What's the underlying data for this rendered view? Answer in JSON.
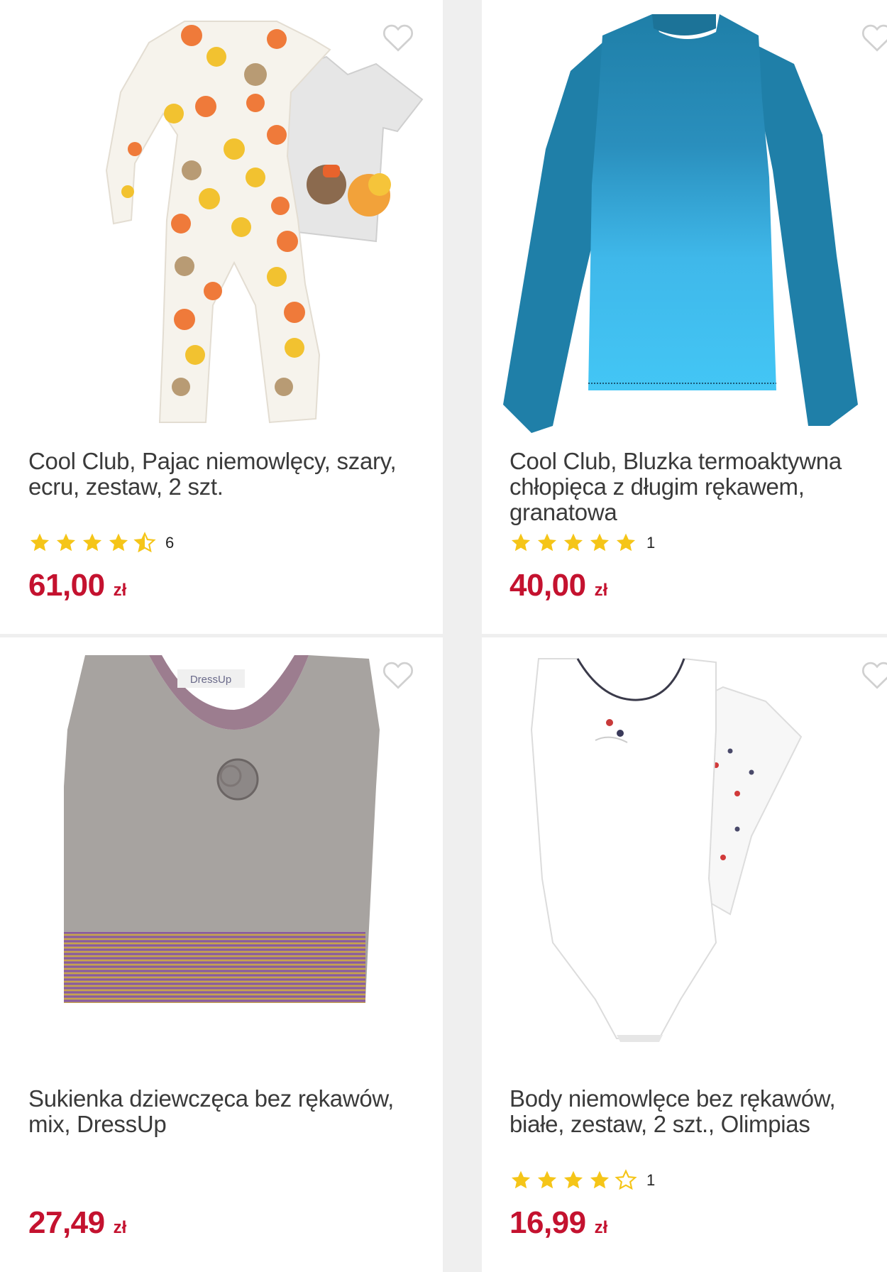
{
  "products": [
    {
      "title": "Cool Club, Pajac niemowlęcy, szary, ecru, zestaw, 2 szt.",
      "rating": 4.5,
      "rating_count": "6",
      "price": "61,00",
      "currency": "zł",
      "image": "pumpkin-print-baby-sleepsuit-set"
    },
    {
      "title": "Cool Club, Bluzka termoaktywna chłopięca z długim rękawem, granatowa",
      "rating": 5,
      "rating_count": "1",
      "price": "40,00",
      "currency": "zł",
      "image": "blue-ombre-long-sleeve-top"
    },
    {
      "title": "Sukienka dziewczęca bez rękawów, mix, DressUp",
      "rating": null,
      "rating_count": "",
      "price": "27,49",
      "currency": "zł",
      "image": "grey-sleeveless-girls-dress",
      "image_label": "DressUp"
    },
    {
      "title": "Body niemowlęce bez rękawów, białe, zestaw, 2 szt., Olimpias",
      "rating": 4,
      "rating_count": "1",
      "price": "16,99",
      "currency": "zł",
      "image": "white-sleeveless-baby-bodysuit-set"
    }
  ],
  "colors": {
    "price": "#c4122f",
    "star": "#f5c518",
    "heart": "#d0d0d0",
    "background": "#efefef"
  }
}
